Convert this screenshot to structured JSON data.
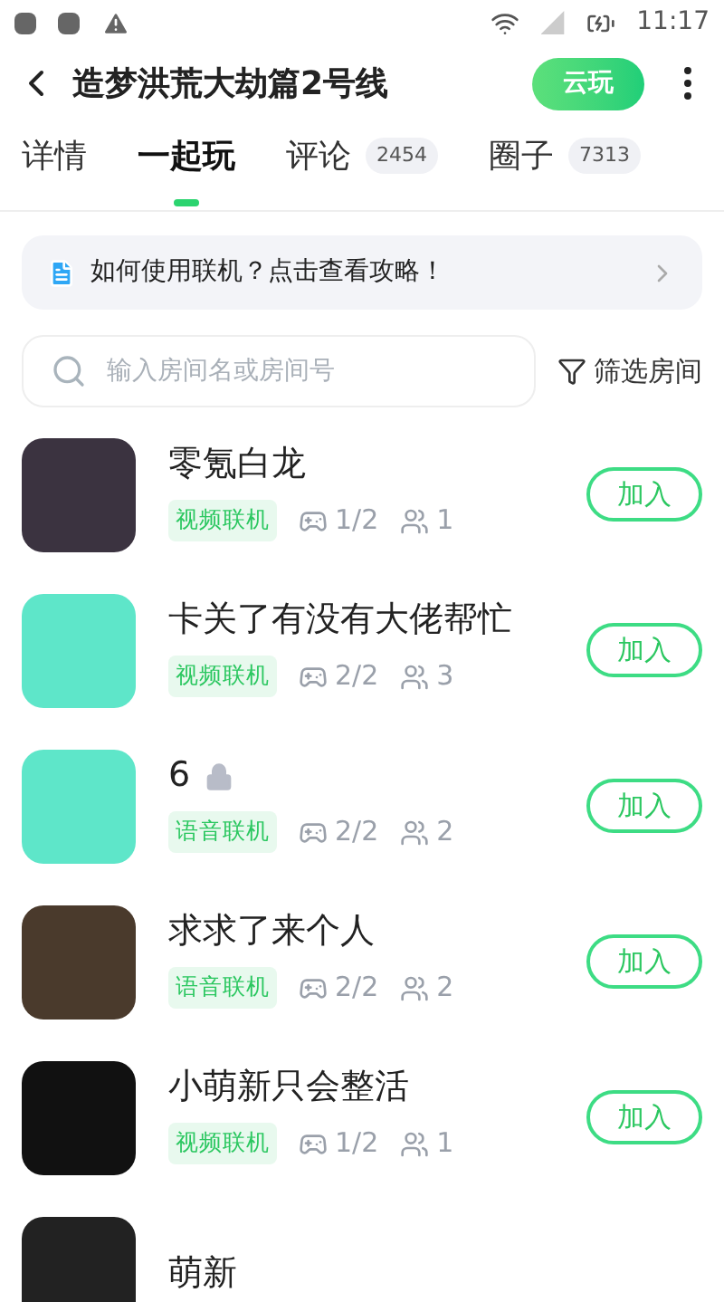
{
  "status_bar": {
    "time": "11:17"
  },
  "header": {
    "title": "造梦洪荒大劫篇2号线",
    "cloud_button": "云玩"
  },
  "tabs": [
    {
      "label": "详情",
      "selected": false
    },
    {
      "label": "一起玩",
      "selected": true
    },
    {
      "label": "评论",
      "count": "2454",
      "selected": false
    },
    {
      "label": "圈子",
      "count": "7313",
      "selected": false
    }
  ],
  "guide_banner": {
    "text": "如何使用联机？点击查看攻略！"
  },
  "search": {
    "placeholder": "输入房间名或房间号",
    "filter_label": "筛选房间"
  },
  "rooms": [
    {
      "name": "零氪白龙",
      "locked": false,
      "mode": "视频联机",
      "players": "1/2",
      "members": "1",
      "join": "加入"
    },
    {
      "name": "卡关了有没有大佬帮忙",
      "locked": false,
      "mode": "视频联机",
      "players": "2/2",
      "members": "3",
      "join": "加入"
    },
    {
      "name": "6",
      "locked": true,
      "mode": "语音联机",
      "players": "2/2",
      "members": "2",
      "join": "加入"
    },
    {
      "name": "求求了来个人",
      "locked": false,
      "mode": "语音联机",
      "players": "2/2",
      "members": "2",
      "join": "加入"
    },
    {
      "name": "小萌新只会整活",
      "locked": false,
      "mode": "视频联机",
      "players": "1/2",
      "members": "1",
      "join": "加入"
    },
    {
      "name": "萌新"
    }
  ]
}
